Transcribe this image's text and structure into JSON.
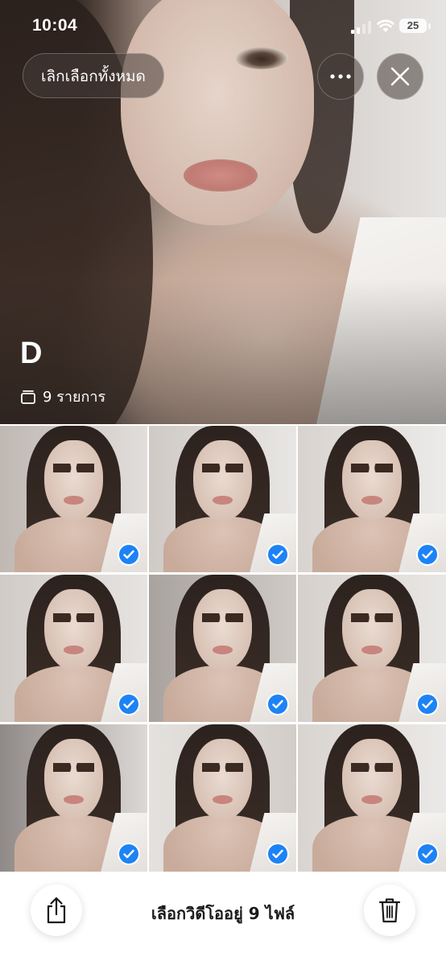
{
  "status_bar": {
    "time": "10:04",
    "battery_level": "25",
    "icons": [
      "cellular-signal-icon",
      "wifi-icon",
      "battery-icon"
    ]
  },
  "top_controls": {
    "deselect_all_label": "เลิกเลือกทั้งหมด",
    "more_icon": "ellipsis-icon",
    "close_icon": "close-icon"
  },
  "album": {
    "title": "D",
    "count_icon": "stack-icon",
    "item_count": "9 รายการ"
  },
  "grid": {
    "items": [
      {
        "selected": true
      },
      {
        "selected": true
      },
      {
        "selected": true
      },
      {
        "selected": true
      },
      {
        "selected": true
      },
      {
        "selected": true
      },
      {
        "selected": true
      },
      {
        "selected": true
      },
      {
        "selected": true
      }
    ],
    "check_icon": "checkmark-icon",
    "accent_color": "#1d83f5"
  },
  "bottom_bar": {
    "share_icon": "share-icon",
    "status_text": "เลือกวิดีโออยู่ 9 ไฟล์",
    "delete_icon": "trash-icon"
  }
}
